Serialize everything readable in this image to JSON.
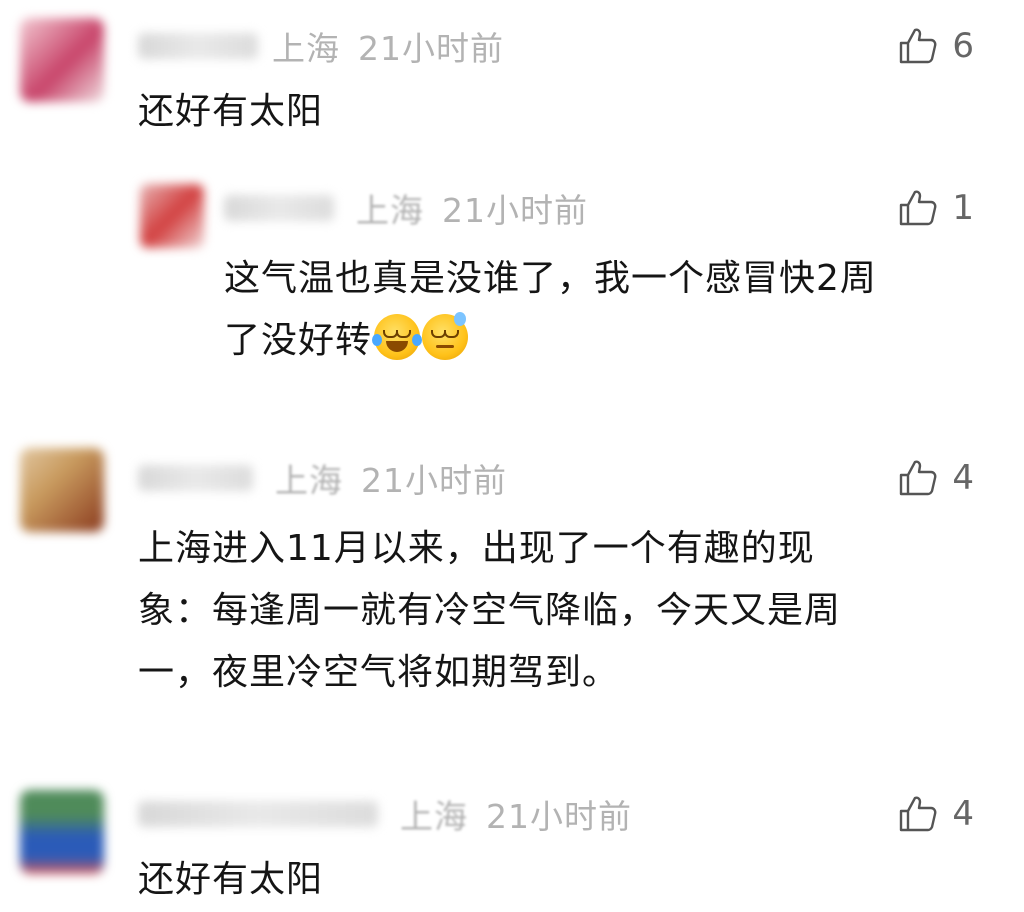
{
  "comments": [
    {
      "location": "上海",
      "time": "21小时前",
      "likes": "6",
      "lines": [
        "还好有太阳"
      ],
      "avatar_colors": [
        "#f3c9d2",
        "#c8446a",
        "#f0dde0"
      ]
    },
    {
      "location": "上海",
      "time": "21小时前",
      "likes": "1",
      "lines": [
        "这气温也真是没谁了，我一个感冒快2周",
        "了没好转"
      ],
      "emojis": [
        "laugh-cry-emoji",
        "sweat-emoji"
      ],
      "avatar_colors": [
        "#e8b5b5",
        "#d24040",
        "#f1d7d7"
      ]
    },
    {
      "location": "上海",
      "time": "21小时前",
      "likes": "4",
      "lines": [
        "上海进入11月以来，出现了一个有趣的现",
        "象：每逢周一就有冷空气降临，今天又是周",
        "一，夜里冷空气将如期驾到。"
      ],
      "avatar_colors": [
        "#c89a5e",
        "#8a3a1e",
        "#e2c7a0"
      ]
    },
    {
      "location": "上海",
      "time": "21小时前",
      "likes": "4",
      "lines": [
        "还好有太阳"
      ],
      "avatar_colors": [
        "#4f8b5a",
        "#2b5bb8",
        "#d85b5b"
      ]
    }
  ]
}
